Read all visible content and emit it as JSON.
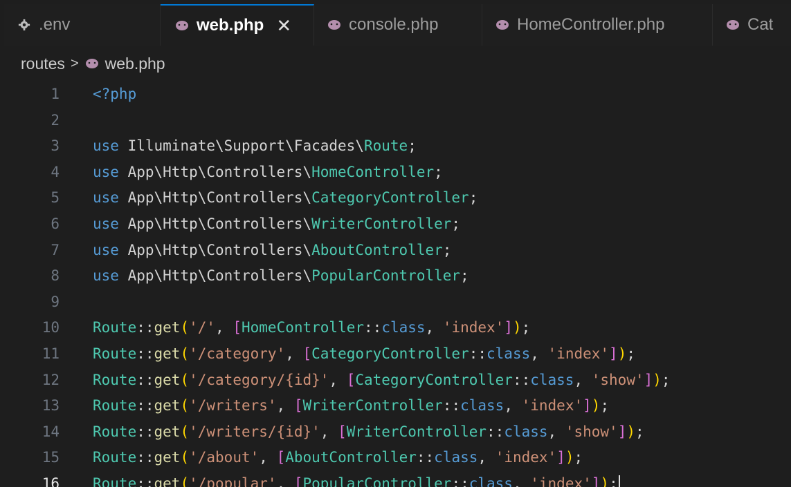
{
  "tabs": [
    {
      "label": ".env",
      "icon": "gear-icon",
      "active": false
    },
    {
      "label": "web.php",
      "icon": "php-elephant-icon",
      "active": true,
      "close": "✕"
    },
    {
      "label": "console.php",
      "icon": "php-elephant-icon",
      "active": false
    },
    {
      "label": "HomeController.php",
      "icon": "php-elephant-icon",
      "active": false
    },
    {
      "label": "Cat",
      "icon": "php-elephant-icon",
      "active": false
    }
  ],
  "breadcrumb": {
    "folder": "routes",
    "separator": ">",
    "file": "web.php"
  },
  "editor": {
    "current_line": "16",
    "lines": [
      {
        "n": "1",
        "text": "<?php"
      },
      {
        "n": "2",
        "text": ""
      },
      {
        "n": "3",
        "text": "use Illuminate\\Support\\Facades\\Route;"
      },
      {
        "n": "4",
        "text": "use App\\Http\\Controllers\\HomeController;"
      },
      {
        "n": "5",
        "text": "use App\\Http\\Controllers\\CategoryController;"
      },
      {
        "n": "6",
        "text": "use App\\Http\\Controllers\\WriterController;"
      },
      {
        "n": "7",
        "text": "use App\\Http\\Controllers\\AboutController;"
      },
      {
        "n": "8",
        "text": "use App\\Http\\Controllers\\PopularController;"
      },
      {
        "n": "9",
        "text": ""
      },
      {
        "n": "10",
        "text": "Route::get('/', [HomeController::class, 'index']);"
      },
      {
        "n": "11",
        "text": "Route::get('/category', [CategoryController::class, 'index']);"
      },
      {
        "n": "12",
        "text": "Route::get('/category/{id}', [CategoryController::class, 'show']);"
      },
      {
        "n": "13",
        "text": "Route::get('/writers', [WriterController::class, 'index']);"
      },
      {
        "n": "14",
        "text": "Route::get('/writers/{id}', [WriterController::class, 'show']);"
      },
      {
        "n": "15",
        "text": "Route::get('/about', [AboutController::class, 'index']);"
      },
      {
        "n": "16",
        "text": "Route::get('/popular', [PopularController::class, 'index']);"
      }
    ]
  },
  "colors": {
    "keyword": "#569cd6",
    "type": "#4ec9b0",
    "function": "#dcdcaa",
    "string": "#ce9178",
    "bracket_outer": "#ffd700",
    "bracket_inner": "#da70d6"
  }
}
